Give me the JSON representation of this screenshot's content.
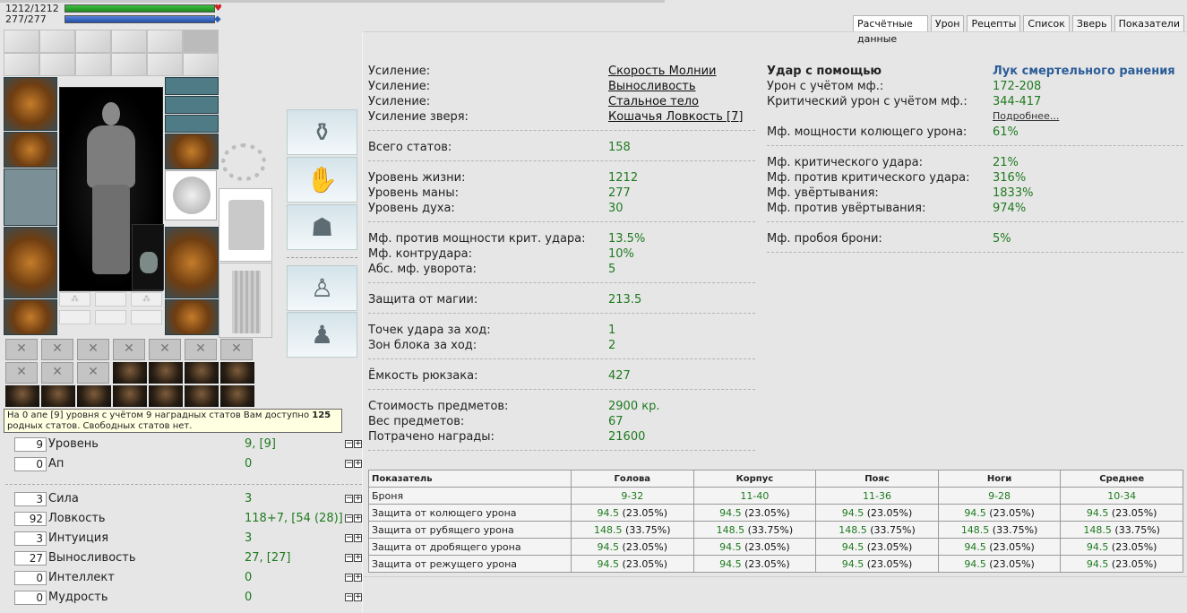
{
  "bars": {
    "hp_text": "1212/1212",
    "mp_text": "277/277",
    "hp_fraction": 1.0,
    "mp_fraction": 1.0
  },
  "tooltip": {
    "part1": "На 0 апе [9] уровня с учётом 9 наградных статов Вам доступно ",
    "count": "125",
    "part2": " родных статов. Свободных статов нет."
  },
  "left_stats_top": [
    {
      "box": "9",
      "name": "Уровень",
      "value": "9, [9]"
    },
    {
      "box": "0",
      "name": "Ап",
      "value": "0"
    }
  ],
  "left_stats": [
    {
      "box": "3",
      "name": "Сила",
      "value": "3"
    },
    {
      "box": "92",
      "name": "Ловкость",
      "value": "118+7, [54 (28)]"
    },
    {
      "box": "3",
      "name": "Интуиция",
      "value": "3"
    },
    {
      "box": "27",
      "name": "Выносливость",
      "value": "27, [27]"
    },
    {
      "box": "0",
      "name": "Интеллект",
      "value": "0"
    },
    {
      "box": "0",
      "name": "Мудрость",
      "value": "0"
    }
  ],
  "tabs": [
    "Расчётные данные",
    "Урон",
    "Рецепты",
    "Список",
    "Зверь",
    "Показатели"
  ],
  "enhancements": [
    {
      "label": "Усиление:",
      "value": "Скорость Молнии"
    },
    {
      "label": "Усиление:",
      "value": "Выносливость"
    },
    {
      "label": "Усиление:",
      "value": "Стальное тело"
    },
    {
      "label": "Усиление зверя:",
      "value": "Кошачья Ловкость [7]"
    }
  ],
  "stats_groups": [
    [
      {
        "label": "Всего статов:",
        "value": "158"
      }
    ],
    [
      {
        "label": "Уровень жизни:",
        "value": "1212"
      },
      {
        "label": "Уровень маны:",
        "value": "277"
      },
      {
        "label": "Уровень духа:",
        "value": "30"
      }
    ],
    [
      {
        "label": "Мф. против мощности крит. удара:",
        "value": "13.5%"
      },
      {
        "label": "Мф. контрудара:",
        "value": "10%"
      },
      {
        "label": "Абс. мф. уворота:",
        "value": "5"
      }
    ],
    [
      {
        "label": "Защита от магии:",
        "value": "213.5"
      }
    ],
    [
      {
        "label": "Точек удара за ход:",
        "value": "1"
      },
      {
        "label": "Зон блока за ход:",
        "value": "2"
      }
    ],
    [
      {
        "label": "Ёмкость рюкзака:",
        "value": "427"
      }
    ],
    [
      {
        "label": "Стоимость предметов:",
        "value": "2900 кр."
      },
      {
        "label": "Вес предметов:",
        "value": "67"
      },
      {
        "label": "Потрачено награды:",
        "value": "21600"
      }
    ]
  ],
  "attack": {
    "heading": "Удар с помощью",
    "weapon": "Лук смертельного ранения",
    "dmg_label": "Урон с учётом мф.:",
    "dmg_value": "172-208",
    "crit_label": "Критический урон с учётом мф.:",
    "crit_value": "344-417",
    "more_link": "Подробнее..."
  },
  "right_groups": [
    [
      {
        "label": "Мф. мощности колющего урона:",
        "value": "61%"
      }
    ],
    [
      {
        "label": "Мф. критического удара:",
        "value": "21%"
      },
      {
        "label": "Мф. против критического удара:",
        "value": "316%"
      },
      {
        "label": "Мф. увёртывания:",
        "value": "1833%"
      },
      {
        "label": "Мф. против увёртывания:",
        "value": "974%"
      }
    ],
    [
      {
        "label": "Мф. пробоя брони:",
        "value": "5%"
      }
    ]
  ],
  "armor_table": {
    "headers": [
      "Показатель",
      "Голова",
      "Корпус",
      "Пояс",
      "Ноги",
      "Среднее"
    ],
    "rows": [
      {
        "name": "Броня",
        "cells": [
          [
            "9-32",
            ""
          ],
          [
            "11-40",
            ""
          ],
          [
            "11-36",
            ""
          ],
          [
            "9-28",
            ""
          ],
          [
            "10-34",
            ""
          ]
        ]
      },
      {
        "name": "Защита от колющего урона",
        "cells": [
          [
            "94.5",
            " (23.05%)"
          ],
          [
            "94.5",
            " (23.05%)"
          ],
          [
            "94.5",
            " (23.05%)"
          ],
          [
            "94.5",
            " (23.05%)"
          ],
          [
            "94.5",
            " (23.05%)"
          ]
        ]
      },
      {
        "name": "Защита от рубящего урона",
        "cells": [
          [
            "148.5",
            " (33.75%)"
          ],
          [
            "148.5",
            " (33.75%)"
          ],
          [
            "148.5",
            " (33.75%)"
          ],
          [
            "148.5",
            " (33.75%)"
          ],
          [
            "148.5",
            " (33.75%)"
          ]
        ]
      },
      {
        "name": "Защита от дробящего урона",
        "cells": [
          [
            "94.5",
            " (23.05%)"
          ],
          [
            "94.5",
            " (23.05%)"
          ],
          [
            "94.5",
            " (23.05%)"
          ],
          [
            "94.5",
            " (23.05%)"
          ],
          [
            "94.5",
            " (23.05%)"
          ]
        ]
      },
      {
        "name": "Защита от режущего урона",
        "cells": [
          [
            "94.5",
            " (23.05%)"
          ],
          [
            "94.5",
            " (23.05%)"
          ],
          [
            "94.5",
            " (23.05%)"
          ],
          [
            "94.5",
            " (23.05%)"
          ],
          [
            "94.5",
            " (23.05%)"
          ]
        ]
      }
    ]
  }
}
